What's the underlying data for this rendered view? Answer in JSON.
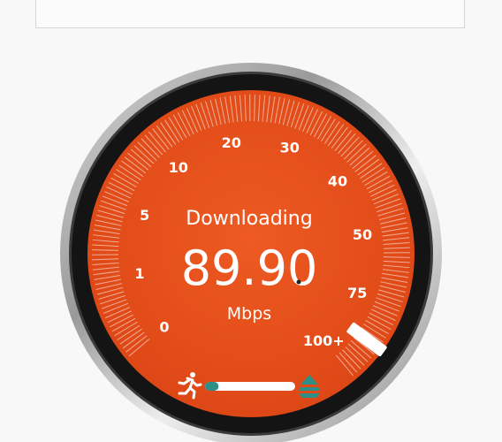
{
  "speedtest": {
    "status": "Downloading",
    "speed_value": "89.90",
    "unit": "Mbps",
    "scale_labels": [
      "0",
      "1",
      "5",
      "10",
      "20",
      "30",
      "40",
      "50",
      "75",
      "100+"
    ],
    "needle_scale_fraction": 0.95,
    "progress_fraction": 0.15
  },
  "icons": {
    "runner": "running-person-icon",
    "layers": "stack-layers-icon"
  },
  "colors": {
    "dial_orange": "#e34b19",
    "bezel_dark": "#141414",
    "progress_fill": "#2e8f86",
    "progress_track": "#ffffff"
  }
}
